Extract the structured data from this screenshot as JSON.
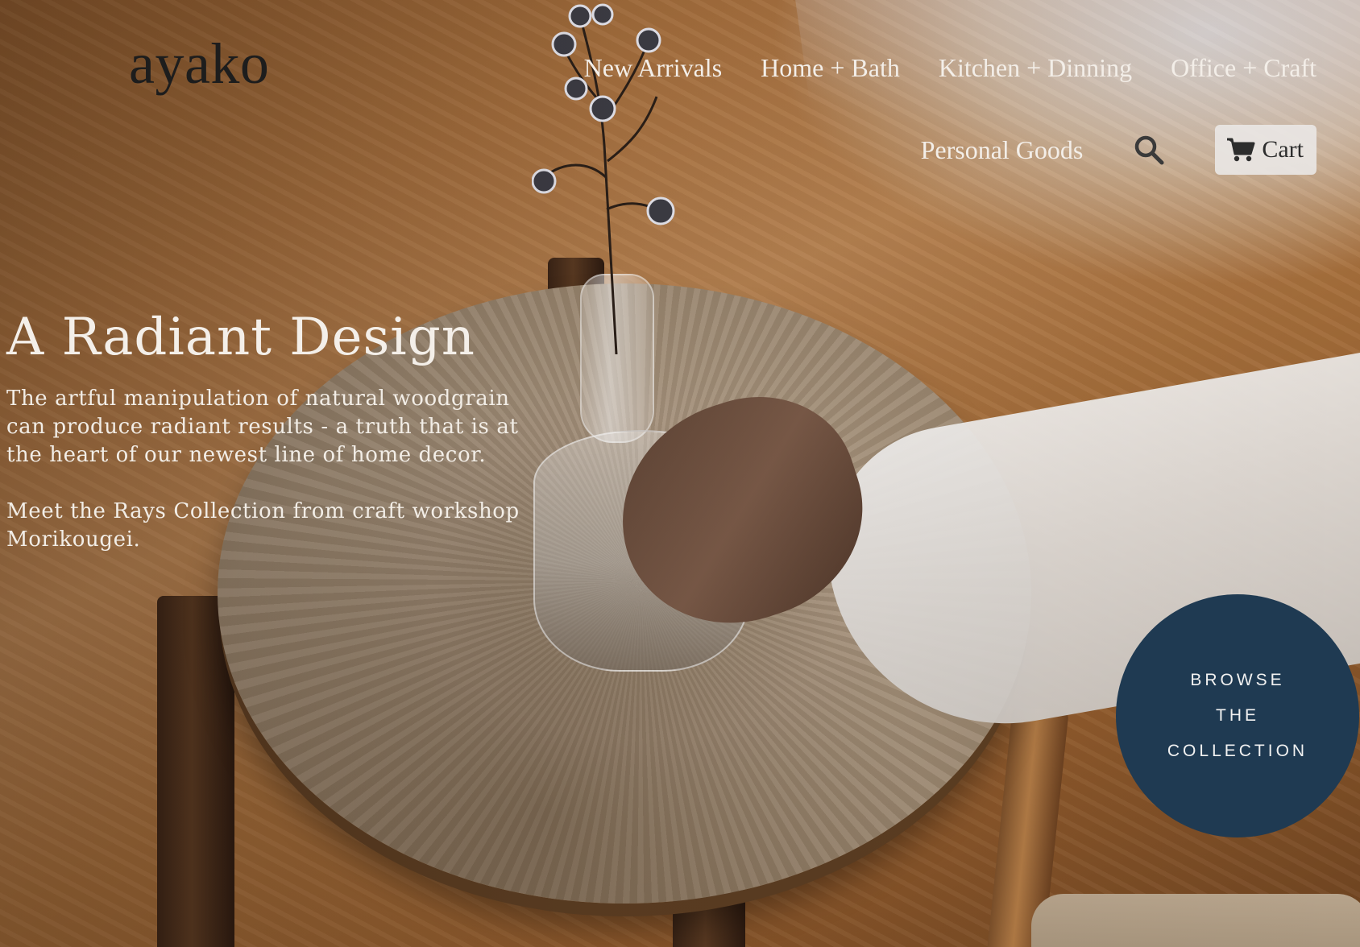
{
  "brand": {
    "logo_text": "ayako"
  },
  "nav": {
    "items": [
      {
        "label": "New Arrivals"
      },
      {
        "label": "Home + Bath"
      },
      {
        "label": "Kitchen + Dinning"
      },
      {
        "label": "Office + Craft"
      },
      {
        "label": "Personal Goods"
      }
    ],
    "search_icon": "search-icon",
    "cart": {
      "label": "Cart",
      "icon": "cart-icon"
    }
  },
  "hero": {
    "title": "A Radiant Design",
    "paragraph_1": "The artful manipulation of natural woodgrain can produce radiant results - a truth that is at the heart of our newest line of home decor.",
    "paragraph_2": "Meet the Rays Collection from craft workshop Morikougei."
  },
  "cta": {
    "line_1": "BROWSE",
    "line_2": "THE",
    "line_3": "COLLECTION",
    "color": "#1f3a52"
  },
  "colors": {
    "nav_text": "#f3eee8",
    "logo": "#1d1d1d",
    "hero_text": "#f4efe9"
  }
}
